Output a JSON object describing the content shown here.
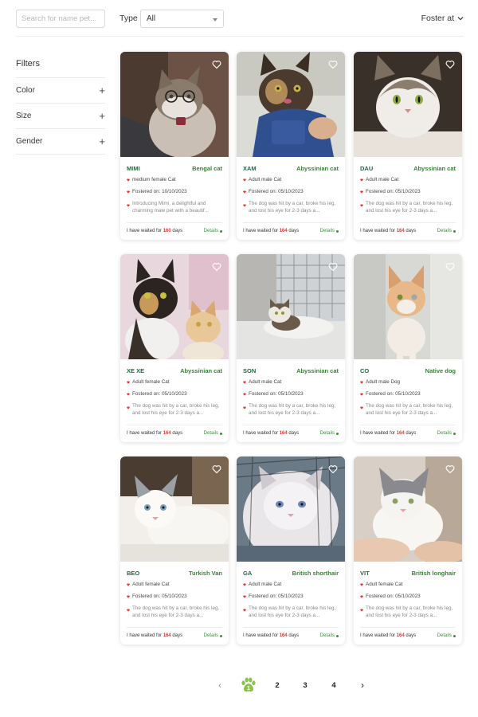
{
  "search": {
    "placeholder": "Search for name pet..."
  },
  "type_filter": {
    "label": "Type",
    "selected": "All"
  },
  "sort": {
    "label": "Foster at"
  },
  "filters": {
    "title": "Filters",
    "items": [
      {
        "label": "Color",
        "icon": "+"
      },
      {
        "label": "Size",
        "icon": "+"
      },
      {
        "label": "Gender",
        "icon": "+"
      }
    ]
  },
  "colors": {
    "brand_green": "#3f8f3f",
    "name_green": "#1f6a3f",
    "accent_red": "#e53935",
    "paw_green": "#8bc34a"
  },
  "waited_prefix": "I have waited for",
  "waited_suffix": "days",
  "details_label": "Details",
  "pets": [
    {
      "name": "MIMI",
      "breed": "Bengal cat",
      "info": "medium female Cat",
      "fostered": "Fostered on: 10/10/2023",
      "desc": "Introducing Mimi, a delightful and charming male pet with a beautif...",
      "days": "160"
    },
    {
      "name": "XAM",
      "breed": "Abyssinian cat",
      "info": "Adult male Cat",
      "fostered": "Fostered on: 05/10/2023",
      "desc": "The dog was hit by a car, broke his leg, and lost his eye for 2-3 days a...",
      "days": "164"
    },
    {
      "name": "DAU",
      "breed": "Abyssinian cat",
      "info": "Adult male Cat",
      "fostered": "Fostered on: 05/10/2023",
      "desc": "The dog was hit by a car, broke his leg, and lost his eye for 2-3 days a...",
      "days": "164"
    },
    {
      "name": "XE XE",
      "breed": "Abyssinian cat",
      "info": "Adult female Cat",
      "fostered": "Fostered on: 05/10/2023",
      "desc": "The dog was hit by a car, broke his leg, and lost his eye for 2-3 days a...",
      "days": "164"
    },
    {
      "name": "SON",
      "breed": "Abyssinian cat",
      "info": "Adult male Cat",
      "fostered": "Fostered on: 05/10/2023",
      "desc": "The dog was hit by a car, broke his leg, and lost his eye for 2-3 days a...",
      "days": "164"
    },
    {
      "name": "CO",
      "breed": "Native dog",
      "info": "Adult male Dog",
      "fostered": "Fostered on: 05/10/2023",
      "desc": "The dog was hit by a car, broke his leg, and lost his eye for 2-3 days a...",
      "days": "164"
    },
    {
      "name": "BEO",
      "breed": "Turkish Van",
      "info": "Adult female Cat",
      "fostered": "Fostered on: 05/10/2023",
      "desc": "The dog was hit by a car, broke his leg, and lost his eye for 2-3 days a...",
      "days": "164"
    },
    {
      "name": "GA",
      "breed": "British shorthair",
      "info": "Adult male Cat",
      "fostered": "Fostered on: 05/10/2023",
      "desc": "The dog was hit by a car, broke his leg, and lost his eye for 2-3 days a...",
      "days": "164"
    },
    {
      "name": "VIT",
      "breed": "British longhair",
      "info": "Adult female Cat",
      "fostered": "Fostered on: 05/10/2023",
      "desc": "The dog was hit by a car, broke his leg, and lost his eye for 2-3 days a...",
      "days": "164"
    }
  ],
  "pagination": {
    "prev_icon": "chevron-left-icon",
    "current_icon": "paw-icon",
    "pages": [
      "2",
      "3",
      "4"
    ],
    "next_icon": "chevron-right-icon"
  }
}
